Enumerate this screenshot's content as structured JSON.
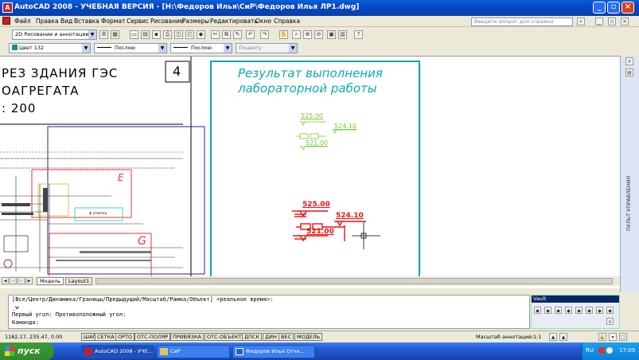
{
  "window": {
    "title": "AutoCAD 2008 - УЧЕБНАЯ ВЕРСИЯ - [H:\\Федоров Илья\\СиР\\Федоров Илья ЛР1.dwg]",
    "app_icon": "autocad-logo-icon"
  },
  "menu": {
    "items": [
      "Файл",
      "Правка",
      "Вид",
      "Вставка",
      "Формат",
      "Сервис",
      "Рисование",
      "Размеры",
      "Редактировать",
      "Окно",
      "Справка"
    ],
    "help_placeholder": "Введите вопрос для справки"
  },
  "toolbar1": {
    "workspace": "2D Рисование и аннотации"
  },
  "toolbar2": {
    "color": "Цвет 132",
    "linetype": "Послою",
    "lineweight": "Послою",
    "plotstyle": "Поцвету"
  },
  "drawing": {
    "left_title_lines": [
      "РЕЗ ЗДАНИЯ ГЭС",
      "ОАГРЕГАТА",
      ": 200"
    ],
    "sheet_number": "4",
    "result_title_lines": [
      "Результат выполнения",
      "лабораторной работы"
    ],
    "green_marks": [
      "525.00",
      "524.10",
      "521.00"
    ],
    "red_marks": [
      "525.00",
      "524.10",
      "521.00"
    ],
    "frame_letters": [
      "Е",
      "G"
    ],
    "detail_label": "ф отметка"
  },
  "layout_tabs": [
    "Модель",
    "Layout1"
  ],
  "vault": {
    "side_label": "ПУЛЬТ УПРАВЛЕНИЯ",
    "panel_title": "Vault"
  },
  "command": {
    "lines": [
      "[Все/Центр/Динамика/Границы/Предыдущий/Масштаб/Рамка/Объект] <реальное время>:",
      "_w",
      "Первый угол: Противоположный угол:",
      "Команда:"
    ]
  },
  "status": {
    "coords": "1182.17, 235.47, 0.00",
    "buttons": [
      "ШАГ",
      "СЕТКА",
      "ОРТО",
      "ОТС-ПОЛЯР",
      "ПРИВЯЗКА",
      "ОТС-ОБЪЕКТ",
      "ДПСК",
      "ДИН",
      "ВЕС",
      "МОДЕЛЬ"
    ],
    "annotation_scale_label": "Масштаб аннотаций:",
    "annotation_scale": "1:1"
  },
  "taskbar": {
    "start": "пуск",
    "items": [
      "AutoCAD 2008 - УЧЕ...",
      "СиР",
      "Федоров Илья Отче..."
    ],
    "lang": "RU",
    "clock": "17:09"
  }
}
